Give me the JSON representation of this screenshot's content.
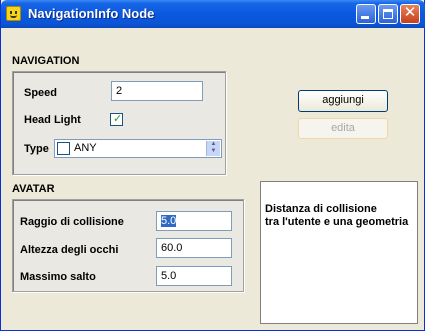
{
  "window": {
    "title": "NavigationInfo Node"
  },
  "title_buttons": {
    "minimize": "minimize-icon",
    "maximize": "maximize-icon",
    "close": "close-icon"
  },
  "navigation": {
    "title": "NAVIGATION",
    "speed": {
      "label": "Speed",
      "value": "2"
    },
    "headlight": {
      "label": "Head Light",
      "checked": true
    },
    "type": {
      "label": "Type",
      "value": "ANY",
      "checked": false
    }
  },
  "avatar": {
    "title": "AVATAR",
    "collision": {
      "label": "Raggio di collisione",
      "value": "5.0"
    },
    "eye_height": {
      "label": "Altezza degli occhi",
      "value": "60.0"
    },
    "max_jump": {
      "label": "Massimo salto",
      "value": "5.0"
    }
  },
  "buttons": {
    "add": "aggiungi",
    "edit": "edita"
  },
  "info": {
    "line1": "Distanza di collisione",
    "line2": "tra l'utente e una geometria"
  }
}
